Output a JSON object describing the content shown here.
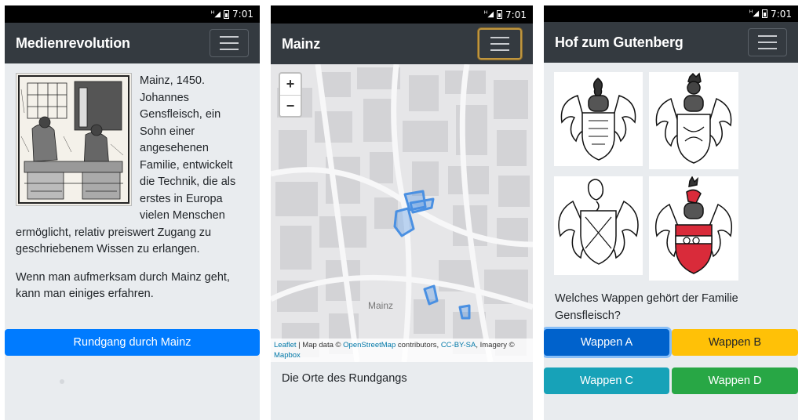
{
  "status": {
    "time": "7:01"
  },
  "screen1": {
    "title": "Medienrevolution",
    "text_first": "Mainz, 1450. Johannes Gensfleisch, ein Sohn einer angesehenen Familie, entwickelt die Technik, die als erstes in Europa vielen Menschen ermöglicht, relativ preiswert Zugang zu geschriebenem Wissen zu erlangen.",
    "text_second": "Wenn man aufmerksam durch Mainz geht, kann man einiges erfahren.",
    "button": "Rundgang durch Mainz"
  },
  "screen2": {
    "title": "Mainz",
    "zoom_in": "+",
    "zoom_out": "−",
    "map_label": "Mainz",
    "attribution": {
      "leaflet": "Leaflet",
      "sep": " | Map data © ",
      "osm": "OpenStreetMap",
      "contributors": " contributors, ",
      "license": "CC-BY-SA",
      "imagery": ", Imagery © ",
      "mapbox": "Mapbox"
    },
    "caption": "Die Orte des Rundgangs"
  },
  "screen3": {
    "title": "Hof zum Gutenberg",
    "question": "Welches Wappen gehört der Familie Gensfleisch?",
    "buttons": {
      "a": "Wappen A",
      "b": "Wappen B",
      "c": "Wappen C",
      "d": "Wappen D"
    }
  },
  "colors": {
    "navbar": "#343a40",
    "primary": "#007bff",
    "warning": "#ffc107",
    "info": "#17a2b8",
    "success": "#28a745",
    "route": "#4a90e2"
  }
}
